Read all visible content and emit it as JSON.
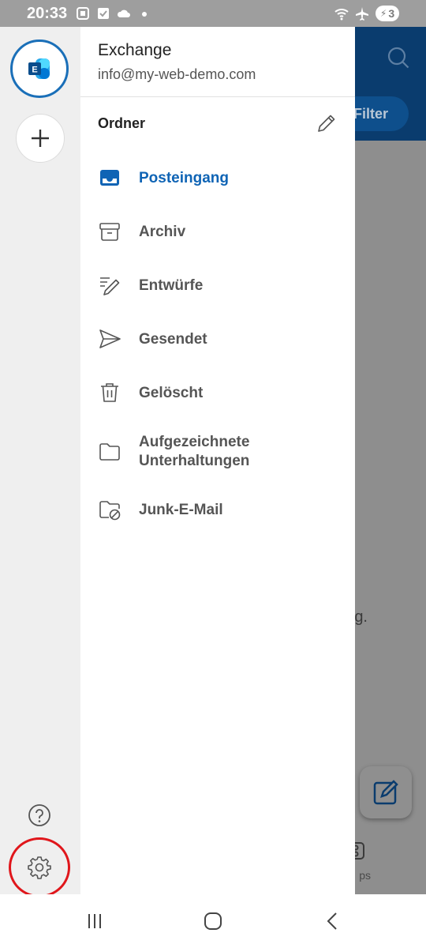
{
  "status_bar": {
    "time": "20:33",
    "left_icons": [
      "screenshot-icon",
      "checkbox-icon",
      "cloud-icon",
      "dot-icon"
    ],
    "right_icons": [
      "wifi-icon",
      "airplane-icon"
    ],
    "battery": "3"
  },
  "background_app": {
    "filter_label": "Filter",
    "partial_text": "g.",
    "apps_label": "ps"
  },
  "account": {
    "name": "Exchange",
    "email": "info@my-web-demo.com",
    "badge_letter": "E"
  },
  "folders": {
    "heading": "Ordner",
    "items": [
      {
        "label": "Posteingang",
        "icon": "inbox-icon",
        "active": true
      },
      {
        "label": "Archiv",
        "icon": "archive-icon"
      },
      {
        "label": "Entwürfe",
        "icon": "drafts-icon"
      },
      {
        "label": "Gesendet",
        "icon": "sent-icon"
      },
      {
        "label": "Gelöscht",
        "icon": "trash-icon"
      },
      {
        "label": "Aufgezeichnete Unterhaltungen",
        "icon": "folder-icon"
      },
      {
        "label": "Junk-E-Mail",
        "icon": "junk-folder-icon"
      }
    ]
  },
  "colors": {
    "accent": "#0f64b5",
    "header": "#0a3c6e",
    "highlight": "#e0161b"
  }
}
